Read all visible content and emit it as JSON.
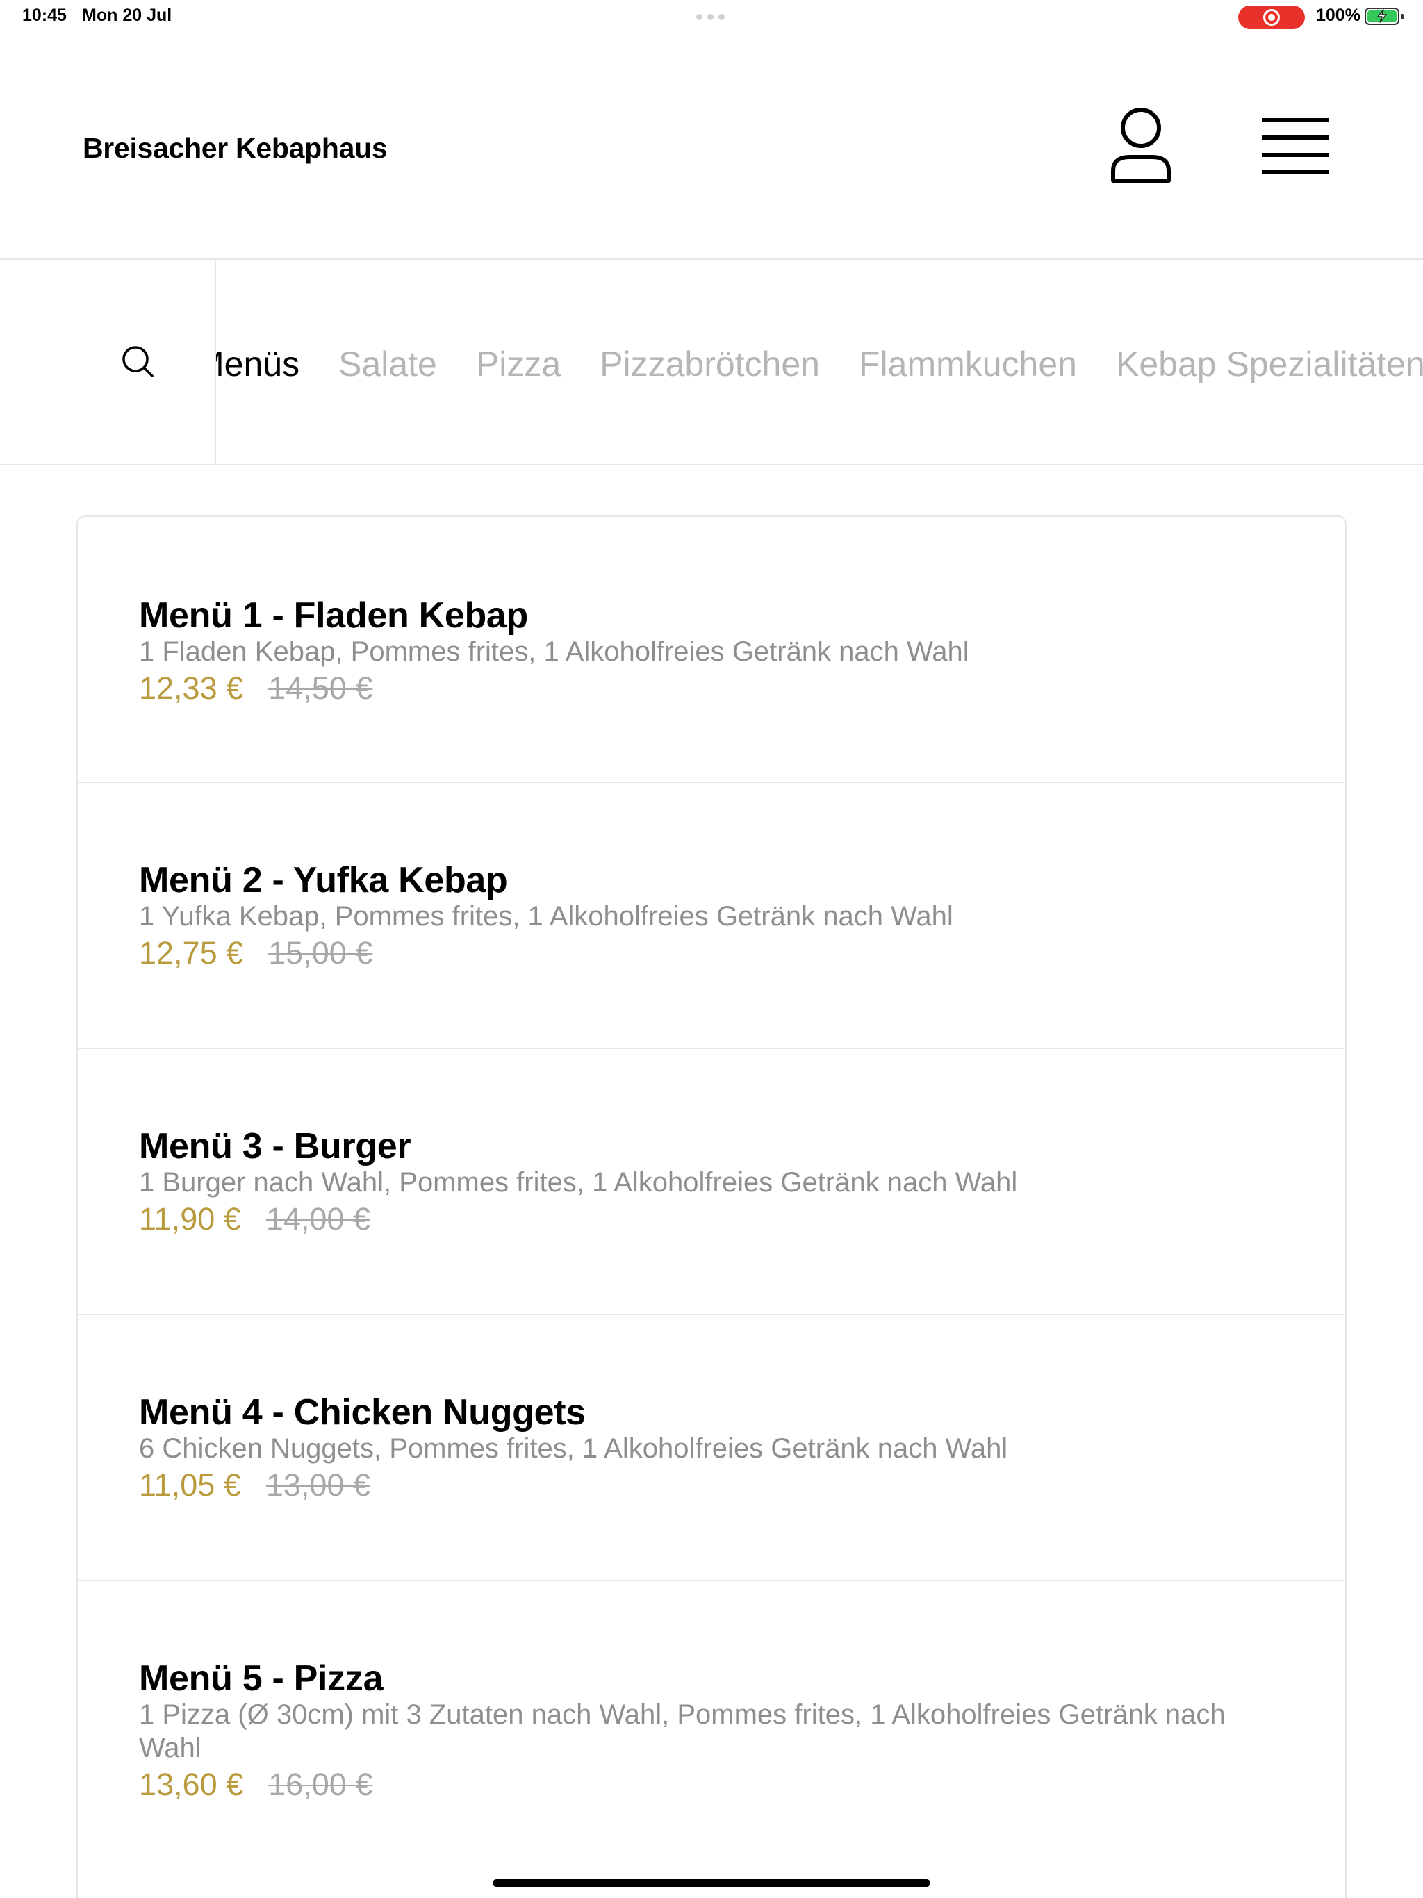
{
  "status_bar": {
    "time": "10:45",
    "date": "Mon 20 Jul",
    "battery_percent": "100%",
    "battery_level": 1.0,
    "recording_color": "#e8312a",
    "battery_color": "#34c759"
  },
  "header": {
    "brand": "Breisacher Kebaphaus",
    "user_icon": "user-icon",
    "menu_icon": "hamburger-icon"
  },
  "categories": {
    "search_icon": "search-icon",
    "items": [
      "Menüs",
      "Salate",
      "Pizza",
      "Pizzabrötchen",
      "Flammkuchen",
      "Kebap Spezialitäten"
    ],
    "active_index": 0
  },
  "menu_items": [
    {
      "title": "Menü 1 - Fladen Kebap",
      "description": "1 Fladen Kebap, Pommes frites, 1 Alkoholfreies Getränk nach Wahl",
      "price": "12,33 €",
      "old_price": "14,50 €"
    },
    {
      "title": "Menü 2 - Yufka Kebap",
      "description": "1 Yufka Kebap, Pommes frites, 1 Alkoholfreies Getränk nach Wahl",
      "price": "12,75 €",
      "old_price": "15,00 €"
    },
    {
      "title": "Menü 3 - Burger",
      "description": "1 Burger nach Wahl, Pommes frites, 1 Alkoholfreies Getränk nach Wahl",
      "price": "11,90 €",
      "old_price": "14,00 €"
    },
    {
      "title": "Menü 4 - Chicken Nuggets",
      "description": "6 Chicken Nuggets, Pommes frites, 1 Alkoholfreies Getränk nach Wahl",
      "price": "11,05 €",
      "old_price": "13,00 €"
    },
    {
      "title": "Menü 5 - Pizza",
      "description": "1 Pizza (Ø 30cm) mit 3 Zutaten nach Wahl, Pommes frites, 1 Alkoholfreies Getränk nach Wahl",
      "price": "13,60 €",
      "old_price": "16,00 €"
    }
  ],
  "colors": {
    "price_accent": "#b99a3c",
    "muted_text": "#8e8e8e",
    "inactive_category": "#b5b5b5"
  }
}
